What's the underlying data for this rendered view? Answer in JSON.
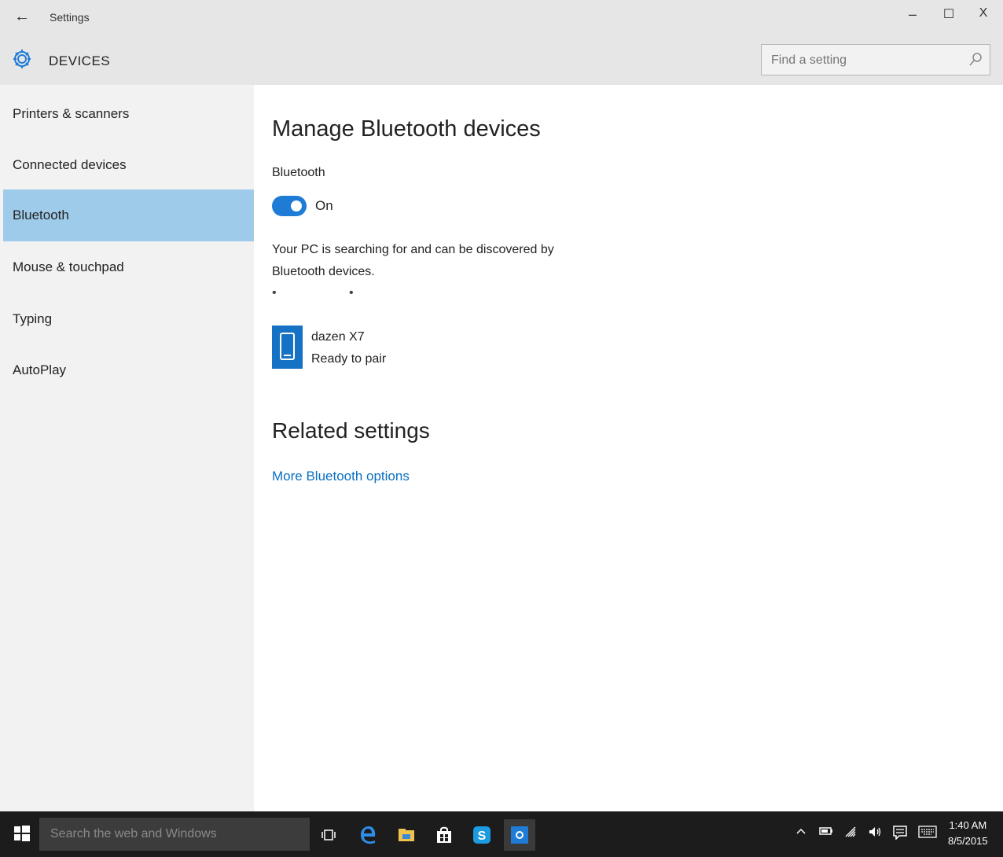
{
  "window": {
    "back_glyph": "←",
    "title": "Settings",
    "minimize_glyph": "–",
    "maximize_glyph": "☐",
    "close_glyph": "X"
  },
  "header": {
    "icon": "gear-icon",
    "section": "DEVICES",
    "search_placeholder": "Find a setting",
    "search_icon": "search-icon"
  },
  "sidebar": {
    "items": [
      {
        "label": "Printers & scanners",
        "active": false
      },
      {
        "label": "Connected devices",
        "active": false
      },
      {
        "label": "Bluetooth",
        "active": true
      },
      {
        "label": "Mouse & touchpad",
        "active": false
      },
      {
        "label": "Typing",
        "active": false
      },
      {
        "label": "AutoPlay",
        "active": false
      }
    ]
  },
  "main": {
    "title": "Manage Bluetooth devices",
    "bluetooth_label": "Bluetooth",
    "toggle_state": "On",
    "description": "Your PC is searching for and can be discovered by Bluetooth devices.",
    "searching_dots": "• •",
    "device": {
      "icon": "phone-icon",
      "name": "dazen X7",
      "status": "Ready to pair"
    },
    "related_title": "Related settings",
    "related_link": "More Bluetooth options"
  },
  "taskbar": {
    "search_text": "Search the web and Windows",
    "apps": [
      "task-view-icon",
      "edge-icon",
      "file-explorer-icon",
      "store-icon",
      "skype-icon",
      "settings-icon"
    ],
    "tray": [
      "chevron-up-icon",
      "battery-icon",
      "wifi-icon",
      "volume-icon",
      "action-center-icon",
      "keyboard-icon"
    ],
    "time": "1:40 AM",
    "date": "8/5/2015"
  },
  "colors": {
    "accent": "#1e7bd6",
    "sidebar_active": "#9fcbeb",
    "link": "#0a6fc2",
    "titlebar": "#e6e6e6",
    "taskbar": "#1c1c1c"
  }
}
